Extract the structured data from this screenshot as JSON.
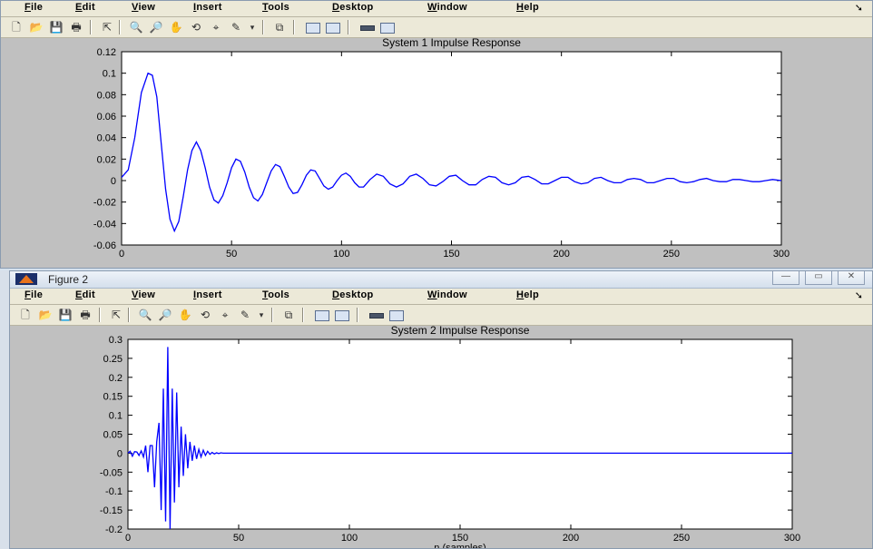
{
  "menus": [
    "File",
    "Edit",
    "View",
    "Insert",
    "Tools",
    "Desktop",
    "Window",
    "Help"
  ],
  "fig1": {
    "plot_title": "System 1 Impulse Response"
  },
  "fig2": {
    "window_title": "Figure 2",
    "plot_title": "System 2 Impulse Response",
    "xlabel": "n (samples)"
  },
  "colors": {
    "trace": "#0000ff",
    "figure_bg": "#c0c0c0",
    "axes_bg": "#ffffff"
  },
  "icons": [
    "new-file-icon",
    "open-folder-icon",
    "save-icon",
    "print-icon",
    "pointer-icon",
    "zoom-in-icon",
    "zoom-out-icon",
    "pan-hand-icon",
    "rotate-3d-icon",
    "data-cursor-icon",
    "brush-icon",
    "link-plot-icon",
    "colorbar-icon",
    "legend-icon",
    "hide-plot-tools-icon",
    "show-plot-tools-icon"
  ],
  "chart_data": [
    {
      "type": "line",
      "title": "System 1 Impulse Response",
      "xlabel": "",
      "ylabel": "",
      "xlim": [
        0,
        300
      ],
      "ylim": [
        -0.06,
        0.12
      ],
      "xticks": [
        0,
        50,
        100,
        150,
        200,
        250,
        300
      ],
      "yticks": [
        0.12,
        0.1,
        0.08,
        0.06,
        0.04,
        0.02,
        0,
        -0.02,
        -0.04,
        -0.06
      ],
      "ytick_labels": [
        "0.12",
        "0.1",
        "0.08",
        "0.06",
        "0.04",
        "0.02",
        "0",
        "-0.02",
        "-0.04",
        "-0.06"
      ],
      "grid": false,
      "series": [
        {
          "x": [
            0,
            3,
            6,
            9,
            12,
            14,
            16,
            18,
            20,
            22,
            24,
            26,
            28,
            30,
            32,
            34,
            36,
            38,
            40,
            42,
            44,
            46,
            48,
            50,
            52,
            54,
            56,
            58,
            60,
            62,
            64,
            66,
            68,
            70,
            72,
            74,
            76,
            78,
            80,
            82,
            84,
            86,
            88,
            90,
            92,
            94,
            96,
            98,
            100,
            102,
            104,
            106,
            108,
            110,
            113,
            116,
            119,
            122,
            125,
            128,
            131,
            134,
            137,
            140,
            143,
            146,
            149,
            152,
            155,
            158,
            161,
            164,
            167,
            170,
            173,
            176,
            179,
            182,
            185,
            188,
            191,
            194,
            197,
            200,
            203,
            206,
            209,
            212,
            215,
            218,
            221,
            224,
            227,
            230,
            233,
            236,
            239,
            242,
            245,
            248,
            251,
            254,
            257,
            260,
            263,
            266,
            269,
            272,
            275,
            278,
            281,
            284,
            287,
            290,
            293,
            296,
            300
          ],
          "y": [
            0.003,
            0.01,
            0.04,
            0.082,
            0.1,
            0.098,
            0.078,
            0.035,
            -0.008,
            -0.036,
            -0.047,
            -0.038,
            -0.015,
            0.01,
            0.028,
            0.036,
            0.028,
            0.012,
            -0.006,
            -0.018,
            -0.021,
            -0.014,
            -0.002,
            0.012,
            0.02,
            0.018,
            0.008,
            -0.006,
            -0.016,
            -0.019,
            -0.013,
            -0.002,
            0.009,
            0.015,
            0.013,
            0.004,
            -0.006,
            -0.012,
            -0.011,
            -0.004,
            0.005,
            0.01,
            0.009,
            0.002,
            -0.005,
            -0.008,
            -0.006,
            0,
            0.005,
            0.007,
            0.004,
            -0.002,
            -0.006,
            -0.006,
            0.001,
            0.006,
            0.004,
            -0.003,
            -0.006,
            -0.003,
            0.004,
            0.006,
            0.002,
            -0.004,
            -0.005,
            -0.001,
            0.004,
            0.005,
            0,
            -0.004,
            -0.004,
            0.001,
            0.004,
            0.003,
            -0.002,
            -0.004,
            -0.002,
            0.003,
            0.004,
            0.001,
            -0.003,
            -0.003,
            0,
            0.003,
            0.003,
            -0.001,
            -0.003,
            -0.002,
            0.002,
            0.003,
            0,
            -0.002,
            -0.002,
            0.001,
            0.002,
            0.001,
            -0.002,
            -0.002,
            0,
            0.002,
            0.002,
            -0.001,
            -0.002,
            -0.001,
            0.001,
            0.002,
            0,
            -0.001,
            -0.001,
            0.001,
            0.001,
            0,
            -0.001,
            -0.001,
            0,
            0.001,
            0
          ]
        }
      ]
    },
    {
      "type": "line",
      "title": "System 2 Impulse Response",
      "xlabel": "n (samples)",
      "ylabel": "",
      "xlim": [
        0,
        300
      ],
      "ylim": [
        -0.2,
        0.3
      ],
      "xticks": [
        0,
        50,
        100,
        150,
        200,
        250,
        300
      ],
      "yticks": [
        0.3,
        0.25,
        0.2,
        0.15,
        0.1,
        0.05,
        0,
        -0.05,
        -0.1,
        -0.15,
        -0.2
      ],
      "ytick_labels": [
        "0.3",
        "0.25",
        "0.2",
        "0.15",
        "0.1",
        "0.05",
        "0",
        "-0.05",
        "-0.1",
        "-0.15",
        "-0.2"
      ],
      "grid": false,
      "series": [
        {
          "x": [
            0,
            1,
            2,
            3,
            4,
            5,
            6,
            7,
            8,
            9,
            10,
            11,
            12,
            13,
            14,
            15,
            16,
            17,
            18,
            19,
            20,
            21,
            22,
            23,
            24,
            25,
            26,
            27,
            28,
            29,
            30,
            31,
            32,
            33,
            34,
            35,
            36,
            37,
            38,
            39,
            40,
            41,
            42,
            43,
            44,
            45,
            300
          ],
          "y": [
            0,
            0.005,
            -0.008,
            0.004,
            0.003,
            -0.006,
            0.006,
            -0.01,
            0.02,
            -0.05,
            0.02,
            0.02,
            -0.09,
            0.03,
            0.08,
            -0.15,
            0.17,
            -0.18,
            0.28,
            -0.2,
            0.17,
            -0.13,
            0.16,
            -0.09,
            0.07,
            -0.06,
            0.05,
            -0.04,
            0.03,
            -0.02,
            0.02,
            -0.015,
            0.01,
            -0.01,
            0.008,
            -0.006,
            0.005,
            -0.003,
            0.002,
            -0.002,
            0.001,
            -0.001,
            0.001,
            0,
            0,
            0,
            0
          ]
        }
      ]
    }
  ]
}
